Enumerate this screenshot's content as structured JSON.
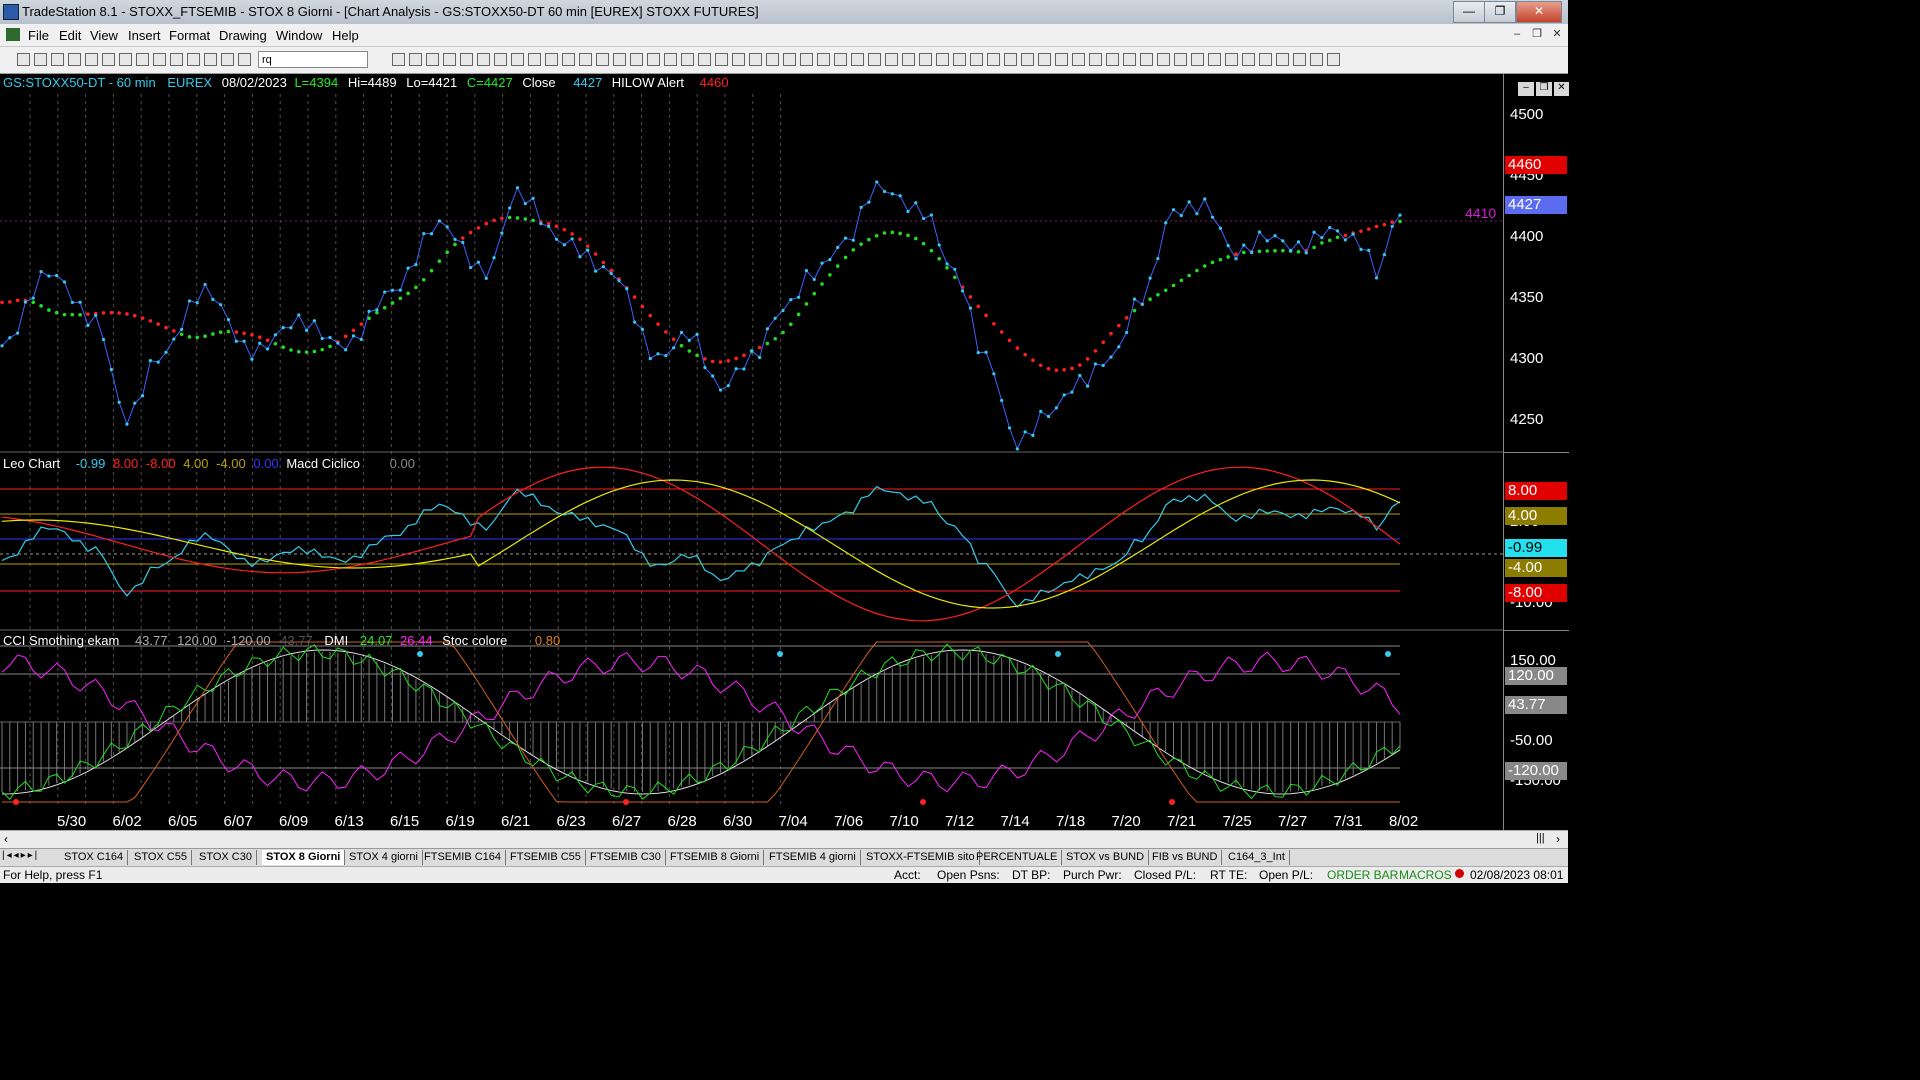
{
  "window": {
    "title": "TradeStation 8.1 - STOXX_FTSEMIB - STOX  8 Giorni - [Chart Analysis - GS:STOXX50-DT  60 min  [EUREX] STOXX FUTURES]",
    "minimize": "—",
    "maximize": "❐",
    "close": "✕"
  },
  "menu": {
    "items": [
      "File",
      "Edit",
      "View",
      "Insert",
      "Format",
      "Drawing",
      "Window",
      "Help"
    ],
    "mdi_min": "–",
    "mdi_restore": "❐",
    "mdi_close": "✕"
  },
  "toolbar": {
    "symbol_input": "rq"
  },
  "price_panel": {
    "header": {
      "symbol": "GS:STOXX50-DT - 60 min",
      "exchange": "EUREX",
      "date": "08/02/2023",
      "last": "L=4394",
      "high": "Hi=4489",
      "low": "Lo=4421",
      "close": "C=4427",
      "close_label": "Close",
      "close_val": "4427",
      "alert_label": "HILOW Alert",
      "alert_val": "4460"
    },
    "axis_ticks": [
      "4500",
      "4450",
      "4400",
      "4350",
      "4300",
      "4250"
    ],
    "badges": {
      "alert": "4460",
      "last": "4427"
    },
    "hline_label": "4410"
  },
  "leo_panel": {
    "header": {
      "name": "Leo Chart",
      "v1": "-0.99",
      "v2": "8.00",
      "v3": "-8.00",
      "v4": "4.00",
      "v5": "-4.00",
      "v6": "0.00",
      "macd_name": "Macd Ciclico",
      "macd_val": "0.00"
    },
    "axis_ticks": [
      "2.00",
      "-10.00"
    ],
    "badges": {
      "b8": "8.00",
      "b4": "4.00",
      "bm099": "-0.99",
      "bm4": "-4.00",
      "bm8": "-8.00"
    }
  },
  "cci_panel": {
    "header": {
      "name": "CCI Smothing ekam",
      "v1": "43.77",
      "v2": "120.00",
      "v3": "-120.00",
      "v4": "43.77",
      "dmi_name": "DMI",
      "dmi1": "24.07",
      "dmi2": "26.44",
      "stoc_name": "Stoc colore",
      "stoc_val": "0.80"
    },
    "axis_ticks": [
      "150.00",
      "-50.00",
      "-150.00"
    ],
    "badges": {
      "b120": "120.00",
      "b4377": "43.77",
      "bm120": "-120.00"
    }
  },
  "dates": [
    "5/30",
    "6/02",
    "6/05",
    "6/07",
    "6/09",
    "6/13",
    "6/15",
    "6/19",
    "6/21",
    "6/23",
    "6/27",
    "6/28",
    "6/30",
    "7/04",
    "7/06",
    "7/10",
    "7/12",
    "7/14",
    "7/18",
    "7/20",
    "7/21",
    "7/25",
    "7/27",
    "7/31",
    "8/02"
  ],
  "tabs": [
    "STOX C164",
    "STOX C55",
    "STOX  C30",
    "STOX  8 Giorni",
    "STOX 4 giorni",
    "FTSEMIB C164",
    "FTSEMIB C55",
    "FTSEMIB C30",
    "FTSEMIB  8 Giorni",
    "FTSEMIB  4 giorni",
    "STOXX-FTSEMIB sito",
    "PERCENTUALE",
    "STOX vs BUND",
    "FIB vs BUND",
    "C164_3_Int"
  ],
  "active_tab": "STOX  8 Giorni",
  "status": {
    "help": "For Help, press F1",
    "acct": "Acct:",
    "open_psns": "Open Psns:",
    "dt_bp": "DT BP:",
    "purch_pwr": "Purch Pwr:",
    "closed_pl": "Closed P/L:",
    "rt_te": "RT TE:",
    "open_pl": "Open P/L:",
    "order_bar": "ORDER BAR",
    "macros": "MACROS",
    "datetime": "02/08/2023 08:01"
  },
  "colors": {
    "cyan": "#33ccee",
    "red": "#ff2020",
    "green": "#22dd22",
    "magenta": "#ff22ff",
    "yellow": "#e8e800",
    "blue": "#3333ff",
    "olive": "#b8a000"
  }
}
